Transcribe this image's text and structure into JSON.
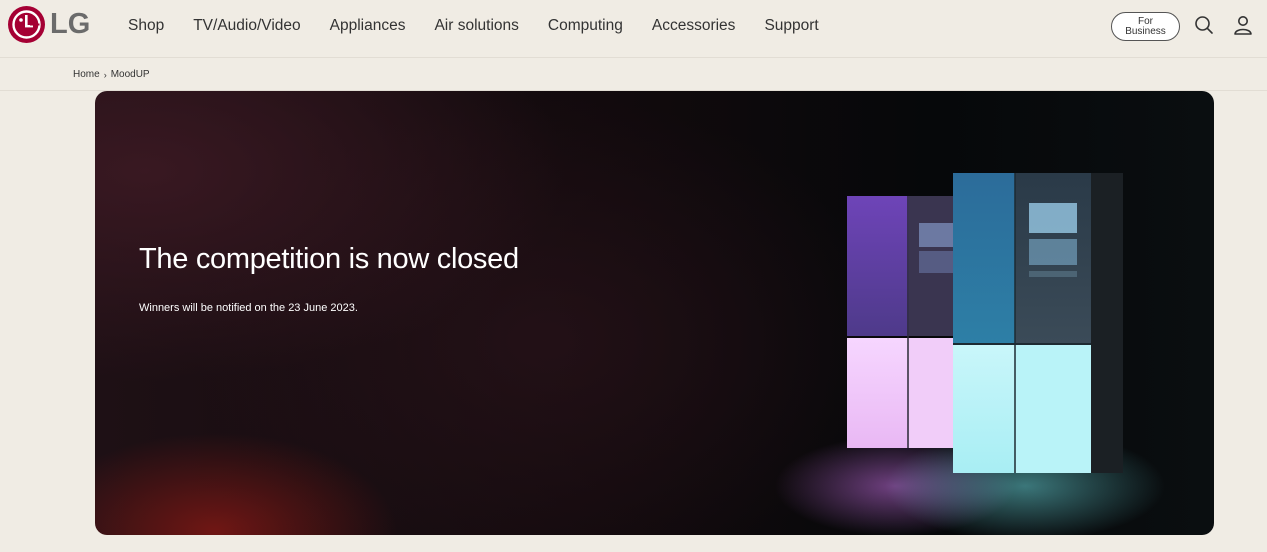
{
  "brand": {
    "logo_text": "LG",
    "color": "#a50034"
  },
  "nav": {
    "items": [
      {
        "label": "Shop"
      },
      {
        "label": "TV/Audio/Video"
      },
      {
        "label": "Appliances"
      },
      {
        "label": "Air solutions"
      },
      {
        "label": "Computing"
      },
      {
        "label": "Accessories"
      },
      {
        "label": "Support"
      }
    ]
  },
  "header": {
    "business_line1": "For",
    "business_line2": "Business",
    "icons": [
      "search-icon",
      "user-icon"
    ]
  },
  "breadcrumb": {
    "home": "Home",
    "separator": "›",
    "current": "MoodUP"
  },
  "hero": {
    "title": "The competition is now closed",
    "subtitle": "Winners will be notified on the 23 June 2023.",
    "image": "lg-moodup-refrigerators"
  }
}
